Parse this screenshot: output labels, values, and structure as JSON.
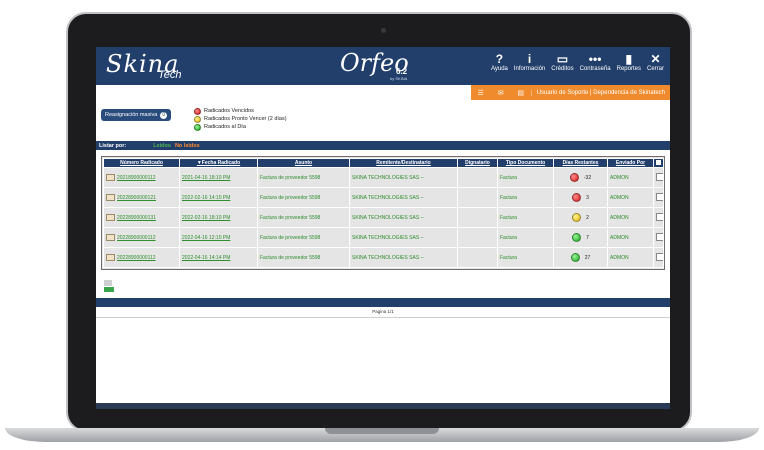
{
  "header": {
    "logo_main": "Skina",
    "logo_sub": "Tech",
    "app_name": "Orfeo",
    "app_version": "6.2",
    "app_by": "by SKINA",
    "nav": [
      {
        "icon": "help-icon",
        "glyph": "?",
        "label": "Ayuda"
      },
      {
        "icon": "info-icon",
        "glyph": "i",
        "label": "Información"
      },
      {
        "icon": "credits-icon",
        "glyph": "▭",
        "label": "Créditos"
      },
      {
        "icon": "password-icon",
        "glyph": "•••",
        "label": "Contraseña"
      },
      {
        "icon": "reports-icon",
        "glyph": "▮",
        "label": "Reportes"
      },
      {
        "icon": "close-icon",
        "glyph": "✕",
        "label": "Cerrar"
      }
    ]
  },
  "orange_bar": {
    "buttons": [
      "☰",
      "✉",
      "▤"
    ],
    "user_label": "Usuario de Soporte | Dependencia de Skinatech"
  },
  "reassign": {
    "label": "Reasignación masiva",
    "count": "0"
  },
  "legend": [
    {
      "color": "red",
      "label": "Radicados Vencidos"
    },
    {
      "color": "yellow",
      "label": "Radicados Pronto Vencer (2 días)"
    },
    {
      "color": "green",
      "label": "Radicados al Día"
    }
  ],
  "list_by": {
    "label": "Listar por:",
    "filter_read": "Leidos",
    "filter_unread": "No leidos"
  },
  "table": {
    "columns": [
      "Número Radicado",
      "▼Fecha Radicado",
      "Asunto",
      "Remitente/Destinatario",
      "Dignatario",
      "Tipo Documento",
      "Días Restantes",
      "Enviado Por"
    ],
    "rows": [
      {
        "numero": "20218900000112",
        "fecha": "2021-04-16 18:10 PM",
        "asunto": "Factura de proveedor 5598",
        "remitente": "SKINA TECHNOLOGIES SAS --",
        "dignatario": "",
        "tipo": "Factura",
        "status": "red",
        "dias": "-32",
        "enviado": "ADMON"
      },
      {
        "numero": "20228900000121",
        "fecha": "2022-02-16 14:10 PM",
        "asunto": "Factura de proveedor 5598",
        "remitente": "SKINA TECHNOLOGIES SAS --",
        "dignatario": "",
        "tipo": "Factura",
        "status": "red",
        "dias": "3",
        "enviado": "ADMON"
      },
      {
        "numero": "20228900000131",
        "fecha": "2022-02-16 18:10 PM",
        "asunto": "Factura de proveedor 5598",
        "remitente": "SKINA TECHNOLOGIES SAS --",
        "dignatario": "",
        "tipo": "Factura",
        "status": "yellow",
        "dias": "2",
        "enviado": "ADMON"
      },
      {
        "numero": "20228900000112",
        "fecha": "2022-04-16 12:10 PM",
        "asunto": "Factura de proveedor 5598",
        "remitente": "SKINA TECHNOLOGIES SAS --",
        "dignatario": "",
        "tipo": "Factura",
        "status": "green",
        "dias": "7",
        "enviado": "ADMON"
      },
      {
        "numero": "20228900000112",
        "fecha": "2022-04-16 14:14 PM",
        "asunto": "Factura de proveedor 5598",
        "remitente": "SKINA TECHNOLOGIES SAS --",
        "dignatario": "",
        "tipo": "Factura",
        "status": "green",
        "dias": "27",
        "enviado": "ADMON"
      }
    ]
  },
  "pager": "Pagina 1/1",
  "colors": {
    "header_bg": "#223f6c",
    "accent_orange": "#ef8b2c",
    "link_green": "#2d8f2d"
  }
}
